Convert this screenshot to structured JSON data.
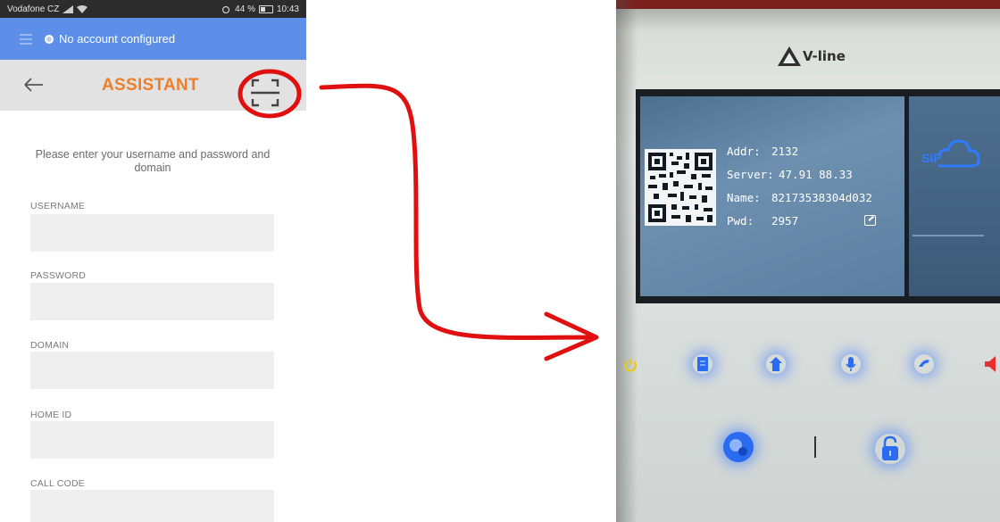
{
  "phone": {
    "status_bar": {
      "carrier": "Vodafone CZ",
      "battery": "44 %",
      "time": "10:43"
    },
    "account_bar": {
      "status_text": "No account configured"
    },
    "title_bar": {
      "title": "ASSISTANT",
      "back_icon": "back-arrow-icon",
      "scan_icon": "qr-scan-icon"
    },
    "form": {
      "intro": "Please enter your username and password and domain",
      "fields": [
        {
          "label": "USERNAME",
          "value": ""
        },
        {
          "label": "PASSWORD",
          "value": ""
        },
        {
          "label": "DOMAIN",
          "value": ""
        },
        {
          "label": "HOME ID",
          "value": ""
        },
        {
          "label": "CALL CODE",
          "value": ""
        }
      ]
    }
  },
  "device": {
    "brand": "V-line",
    "screen": {
      "addr_label": "Addr:",
      "addr_value": "2132",
      "server_label": "Server:",
      "server_value": "47.91 88.33",
      "name_label": "Name:",
      "name_value": "82173538304d032",
      "pwd_label": "Pwd:",
      "pwd_value": "2957",
      "side_label": "SIP"
    }
  },
  "colors": {
    "account_bar": "#5d8ee8",
    "title_orange": "#ef7e28",
    "annotation_red": "#e01010",
    "led_blue": "#2a6cf0",
    "led_yellow": "#e8c81a",
    "led_red": "#e83030"
  }
}
